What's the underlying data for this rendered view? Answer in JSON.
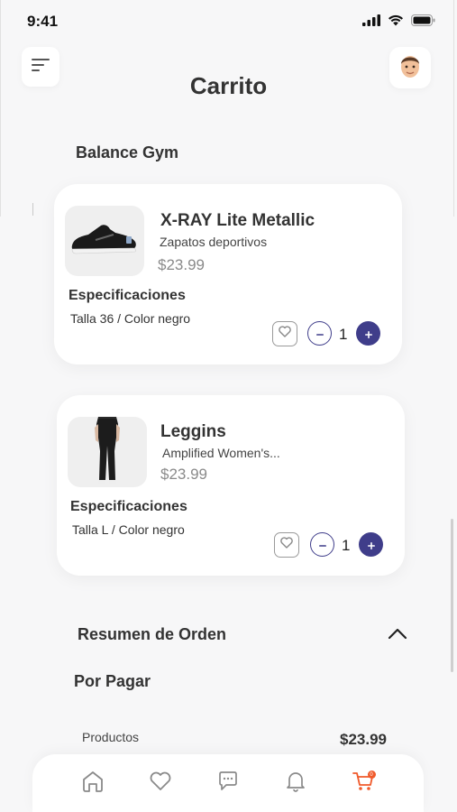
{
  "status_bar": {
    "time": "9:41"
  },
  "header": {
    "title": "Carrito"
  },
  "store": {
    "name": "Balance Gym"
  },
  "cart_items": [
    {
      "name": "X-RAY Lite Metallic",
      "subtitle": "Zapatos deportivos",
      "price": "$23.99",
      "specs_title": "Especificaciones",
      "specs": "Talla 36 / Color negro",
      "quantity": "1",
      "image_icon": "sneaker-image"
    },
    {
      "name": "Leggins",
      "subtitle": "Amplified Women's...",
      "price": "$23.99",
      "specs_title": "Especificaciones",
      "specs": "Talla L / Color negro",
      "quantity": "1",
      "image_icon": "leggings-image"
    }
  ],
  "summary": {
    "title": "Resumen de Orden",
    "pay_title": "Por Pagar",
    "rows": [
      {
        "label": "Productos",
        "value": "$23.99"
      }
    ]
  },
  "tab_bar": {
    "items": [
      "home-icon",
      "heart-icon",
      "chat-icon",
      "bell-icon",
      "cart-icon"
    ],
    "active": "cart-icon",
    "cart_badge": "0"
  },
  "colors": {
    "accent": "#3f3d8a",
    "active_tab": "#f05a2b",
    "background": "#f7f7f8"
  }
}
